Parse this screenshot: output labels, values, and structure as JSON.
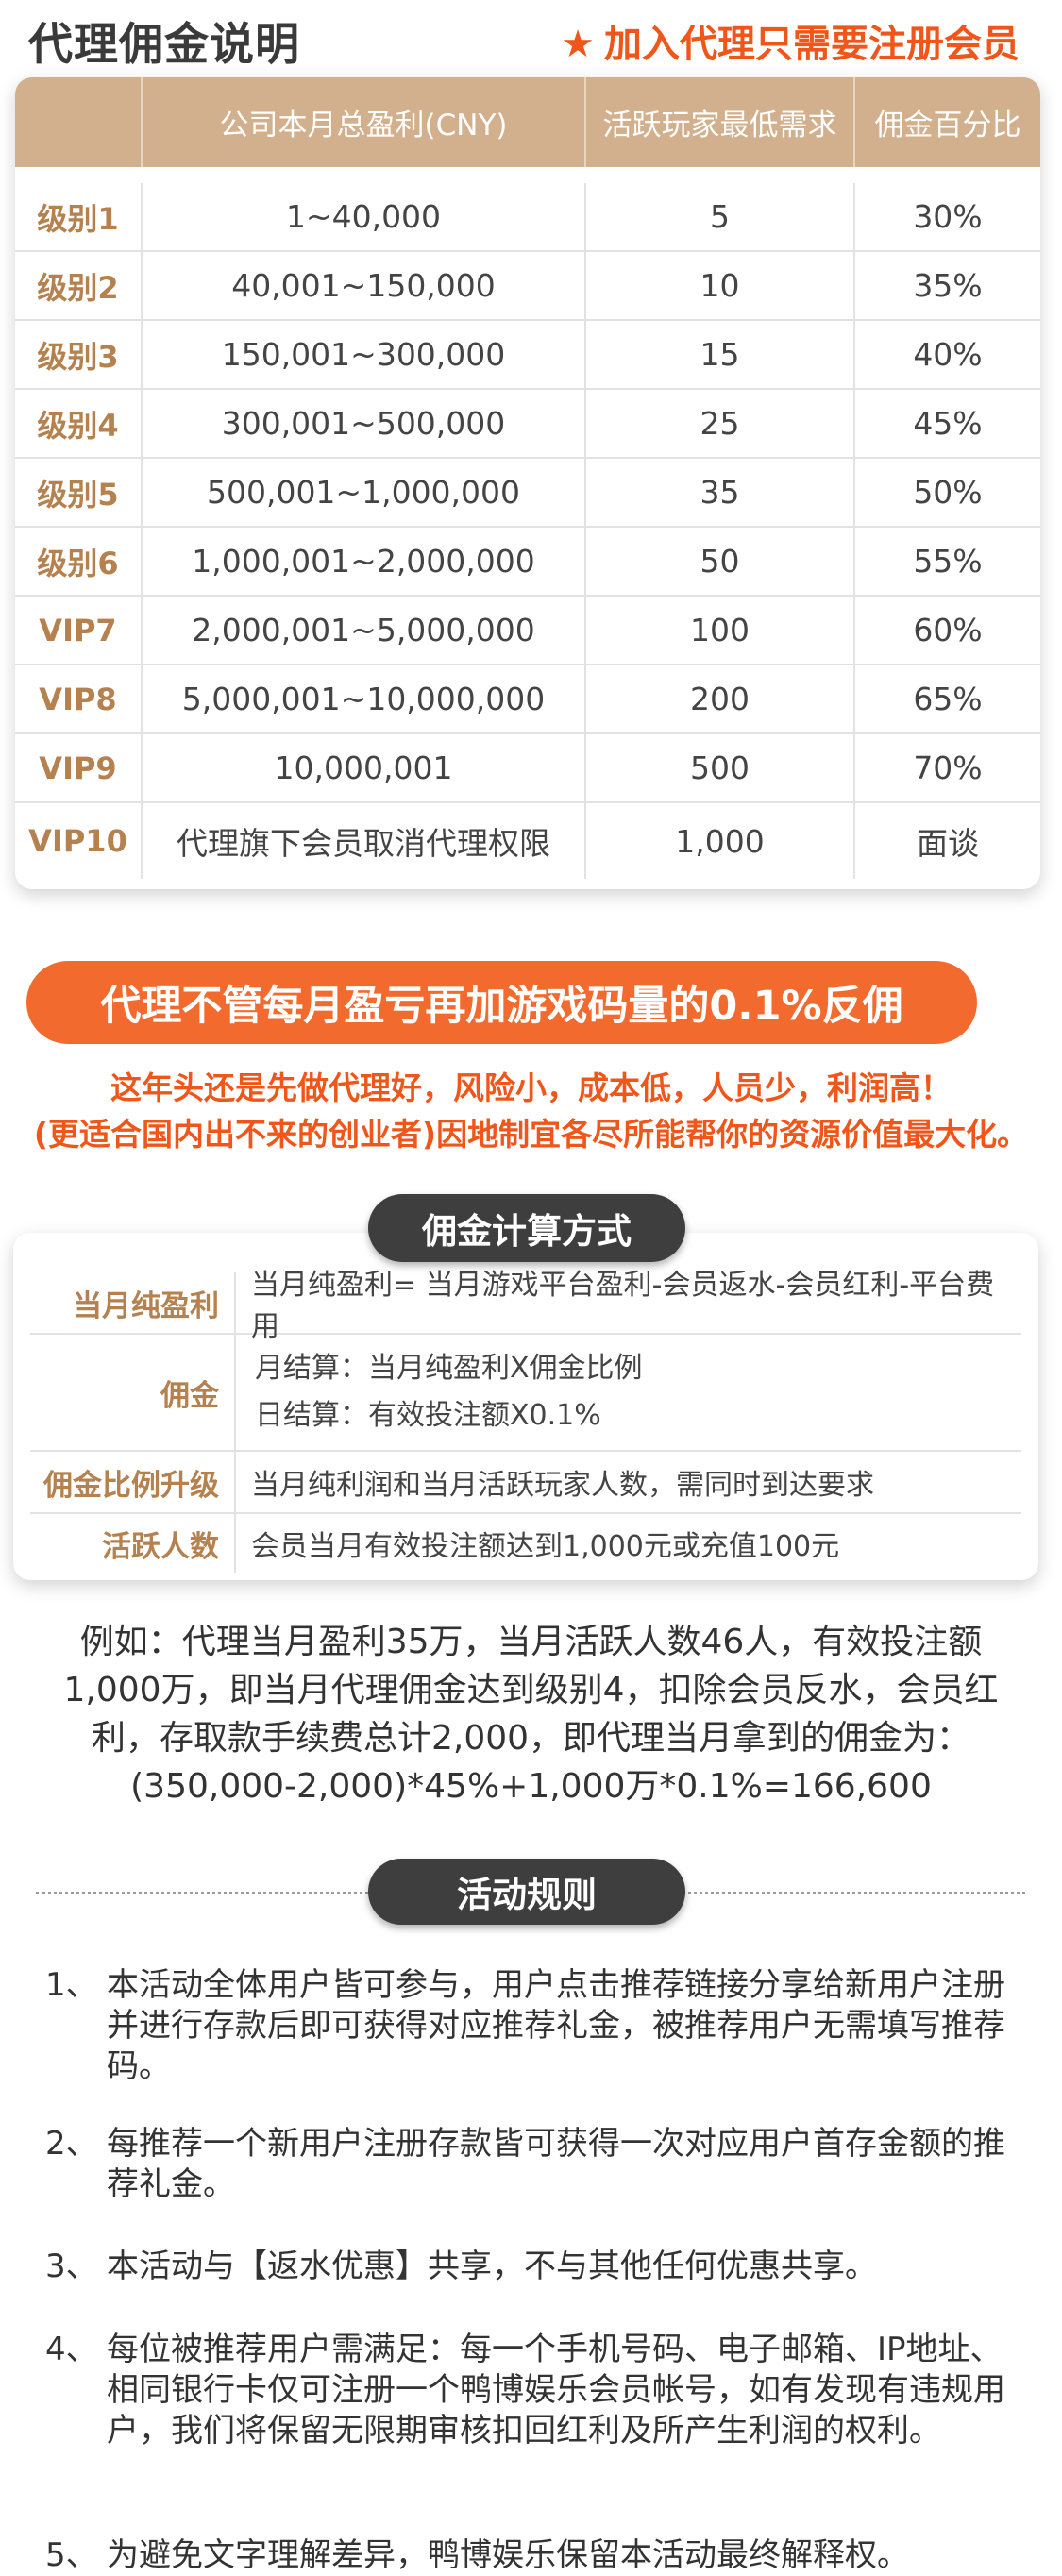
{
  "header": {
    "title": "代理佣金说明",
    "promo_icon": "star-icon",
    "promo": "加入代理只需要注册会员"
  },
  "commission_table": {
    "headers": [
      "",
      "公司本月总盈利(CNY)",
      "活跃玩家最低需求",
      "佣金百分比"
    ],
    "rows": [
      {
        "level": "级别1",
        "profit": "1~40,000",
        "players": "5",
        "percent": "30%"
      },
      {
        "level": "级别2",
        "profit": "40,001~150,000",
        "players": "10",
        "percent": "35%"
      },
      {
        "level": "级别3",
        "profit": "150,001~300,000",
        "players": "15",
        "percent": "40%"
      },
      {
        "level": "级别4",
        "profit": "300,001~500,000",
        "players": "25",
        "percent": "45%"
      },
      {
        "level": "级别5",
        "profit": "500,001~1,000,000",
        "players": "35",
        "percent": "50%"
      },
      {
        "level": "级别6",
        "profit": "1,000,001~2,000,000",
        "players": "50",
        "percent": "55%"
      },
      {
        "level": "VIP7",
        "profit": "2,000,001~5,000,000",
        "players": "100",
        "percent": "60%"
      },
      {
        "level": "VIP8",
        "profit": "5,000,001~10,000,000",
        "players": "200",
        "percent": "65%"
      },
      {
        "level": "VIP9",
        "profit": "10,000,001",
        "players": "500",
        "percent": "70%"
      },
      {
        "level": "VIP10",
        "profit": "代理旗下会员取消代理权限",
        "players": "1,000",
        "percent": "面谈"
      }
    ]
  },
  "banner": "代理不管每月盈亏再加游戏码量的0.1%反佣",
  "slogan": {
    "line1": "这年头还是先做代理好，风险小，成本低，人员少，利润高！",
    "line2": "(更适合国内出不来的创业者)因地制宜各尽所能帮你的资源价值最大化。"
  },
  "calc": {
    "title": "佣金计算方式",
    "rows": [
      {
        "label": "当月纯盈利",
        "value": "当月纯盈利= 当月游戏平台盈利-会员返水-会员红利-平台费用"
      },
      {
        "label": "佣金",
        "line1": "月结算：当月纯盈利X佣金比例",
        "line2": "日结算：有效投注额X0.1%"
      },
      {
        "label": "佣金比例升级",
        "value": "当月纯利润和当月活跃玩家人数，需同时到达要求"
      },
      {
        "label": "活跃人数",
        "value": "会员当月有效投注额达到1,000元或充值100元"
      }
    ]
  },
  "example": {
    "line1": "例如：代理当月盈利35万，当月活跃人数46人，有效投注额",
    "line2": "1,000万，即当月代理佣金达到级别4，扣除会员反水，会员红",
    "line3": "利，存取款手续费总计2,000，即代理当月拿到的佣金为：",
    "line4": "(350,000-2,000)*45%+1,000万*0.1%=166,600"
  },
  "rules": {
    "title": "活动规则",
    "items": [
      {
        "num": "1、",
        "text": "本活动全体用户皆可参与，用户点击推荐链接分享给新用户注册并进行存款后即可获得对应推荐礼金，被推荐用户无需填写推荐码。"
      },
      {
        "num": "2、",
        "text": "每推荐一个新用户注册存款皆可获得一次对应用户首存金额的推荐礼金。"
      },
      {
        "num": "3、",
        "text": "本活动与【返水优惠】共享，不与其他任何优惠共享。"
      },
      {
        "num": "4、",
        "text": "每位被推荐用户需满足：每一个手机号码、电子邮箱、IP地址、相同银行卡仅可注册一个鸭博娱乐会员帐号，如有发现有违规用户，我们将保留无限期审核扣回红利及所产生利润的权利。"
      },
      {
        "num": "5、",
        "text": "为避免文字理解差异，鸭博娱乐保留本活动最终解释权。"
      }
    ]
  }
}
